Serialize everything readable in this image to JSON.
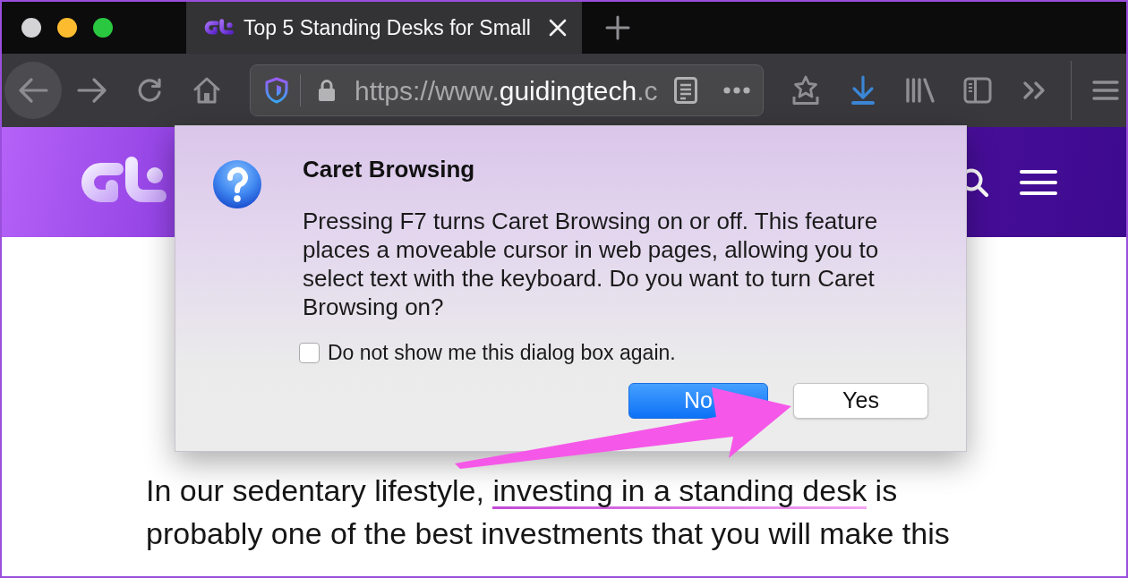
{
  "tabs": [
    {
      "title": "Top 5 Standing Desks for Small",
      "selected": true
    }
  ],
  "toolbar": {
    "url": {
      "scheme": "https://www.",
      "domain": "guidingtech",
      "rest": ".c"
    },
    "downloads_attention": true
  },
  "dialog": {
    "title": "Caret Browsing",
    "message": "Pressing F7 turns Caret Browsing on or off. This feature places a moveable cursor in web pages, allowing you to select text with the keyboard. Do you want to turn Caret Browsing on?",
    "checkbox": {
      "label": "Do not show me this dialog box again.",
      "checked": false
    },
    "buttons": [
      {
        "label": "No",
        "default": true
      },
      {
        "label": "Yes",
        "default": false
      }
    ]
  },
  "article": {
    "paragraph": [
      {
        "kind": "text",
        "text": "In our sedentary lifestyle, "
      },
      {
        "kind": "link",
        "text": "investing in a standing desk"
      },
      {
        "kind": "text",
        "text": " is probably one of the best investments that you will make this"
      }
    ]
  }
}
